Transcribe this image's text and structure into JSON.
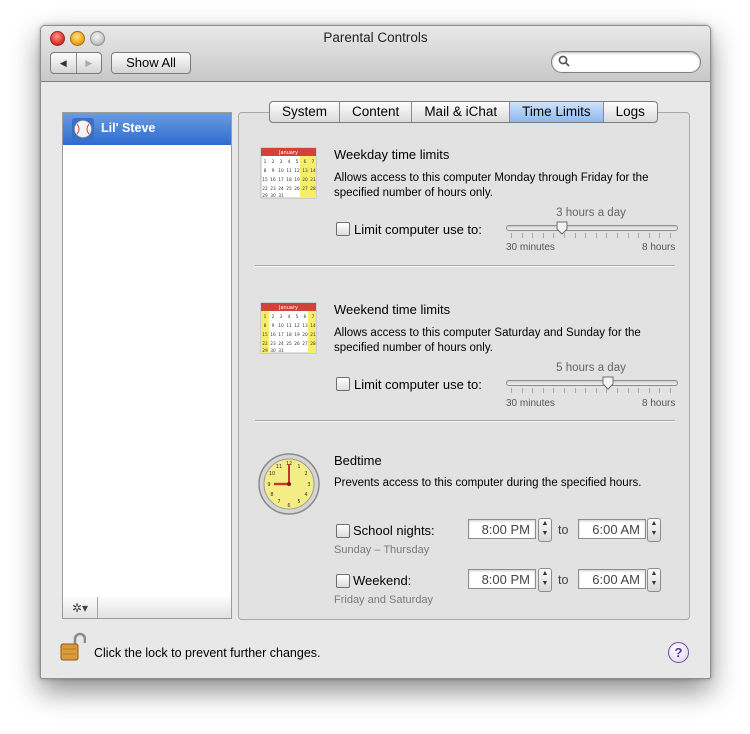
{
  "window": {
    "title": "Parental Controls"
  },
  "toolbar": {
    "show_all_label": "Show All",
    "search_placeholder": ""
  },
  "users": [
    {
      "name": "Lil' Steve"
    }
  ],
  "tabs": [
    "System",
    "Content",
    "Mail & iChat",
    "Time Limits",
    "Logs"
  ],
  "active_tab": "Time Limits",
  "weekday": {
    "title": "Weekday time limits",
    "description": "Allows access to this computer Monday through Friday for the specified number of hours only.",
    "checkbox_label": "Limit computer use to:",
    "checked": false,
    "slider_value_label": "3 hours a day",
    "slider_fraction": 0.33,
    "min_label": "30 minutes",
    "max_label": "8 hours",
    "calendar_month": "January"
  },
  "weekend": {
    "title": "Weekend time limits",
    "description": "Allows access to this computer Saturday and Sunday for the specified number of hours only.",
    "checkbox_label": "Limit computer use to:",
    "checked": false,
    "slider_value_label": "5 hours a day",
    "slider_fraction": 0.6,
    "min_label": "30 minutes",
    "max_label": "8 hours",
    "calendar_month": "January"
  },
  "bedtime": {
    "title": "Bedtime",
    "description": "Prevents access to this computer during the specified hours.",
    "school_nights": {
      "label": "School nights:",
      "sub": "Sunday – Thursday",
      "from": "8:00 PM",
      "to": "6:00 AM",
      "checked": false
    },
    "weekend": {
      "label": "Weekend:",
      "sub": "Friday and Saturday",
      "from": "8:00 PM",
      "to": "6:00 AM",
      "checked": false
    },
    "to_label": "to"
  },
  "footer": {
    "lock_text": "Click the lock to prevent further changes.",
    "help_label": "?"
  },
  "icons": {
    "search": "search-icon",
    "gear": "gear-icon",
    "lock": "lock-icon",
    "help": "help-icon",
    "calendar": "calendar-icon",
    "clock": "clock-icon"
  }
}
